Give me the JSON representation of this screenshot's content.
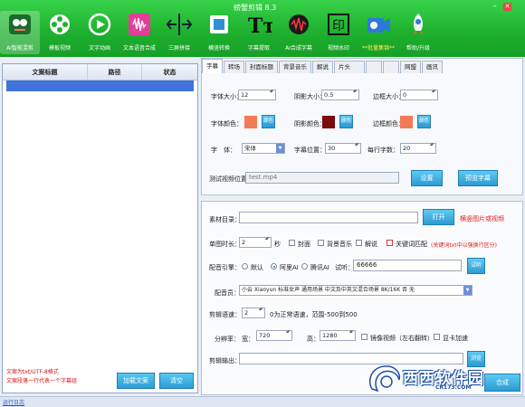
{
  "app": {
    "title": "螃蟹剪辑 8.3"
  },
  "toolbar": {
    "items": [
      {
        "label": "AI智能混剪",
        "icon": "ai-brain-icon"
      },
      {
        "label": "模板视频",
        "icon": "film-reel-icon"
      },
      {
        "label": "文字动画",
        "icon": "text-animation-icon"
      },
      {
        "label": "文本语音合成",
        "icon": "voice-wave-icon"
      },
      {
        "label": "三屏拼接",
        "icon": "split-screen-icon"
      },
      {
        "label": "横竖转换",
        "icon": "rotate-screen-icon"
      },
      {
        "label": "字幕提取",
        "icon": "text-extract-icon"
      },
      {
        "label": "AI合成字幕",
        "icon": "ai-subtitle-icon"
      },
      {
        "label": "视频水印",
        "icon": "watermark-stamp-icon"
      },
      {
        "label": "**批量集锦**",
        "icon": "batch-video-icon"
      },
      {
        "label": "帮助/升级",
        "icon": "rocket-icon"
      }
    ]
  },
  "left": {
    "headers": [
      "文案标题",
      "路径",
      "状态"
    ],
    "hints": [
      "文案为txt/UTF-8格式",
      "文案段落一行代表一个字幕组"
    ],
    "load_button": "加载文案",
    "clear_button": "清空"
  },
  "tabs": [
    "字幕",
    "转场",
    "封面标题",
    "背景音乐",
    "解说",
    "片头",
    "",
    "",
    "网盟",
    "画讯"
  ],
  "subtitle": {
    "font_size_label": "字体大小：",
    "font_size": "12",
    "shadow_size_label": "阴影大小：",
    "shadow_size": "0.5",
    "border_size_label": "边框大小：",
    "border_size": "0",
    "font_color_label": "字体颜色：",
    "shadow_color_label": "阴影颜色：",
    "border_color_label": "边框颜色：",
    "color_button": "颜色",
    "font_label": "字　体：",
    "font_value": "宋体",
    "subtitle_pos_label": "字幕位置：",
    "subtitle_pos": "30",
    "chars_per_line_label": "每行字数：",
    "chars_per_line": "20",
    "test_video_label": "测试视频位置：",
    "test_video": "test.mp4",
    "set_button": "设置",
    "preview_button": "预览字幕",
    "colors": {
      "font": "#f27a56",
      "shadow": "#7a0c0c",
      "border": "#f27a56"
    }
  },
  "material": {
    "dir_label": "素材目录：",
    "dir_value": "",
    "open_button": "打开",
    "dir_hint": "横竖图片或视频",
    "duration_label": "单图时长：",
    "duration": "2",
    "seconds": "秒",
    "cover_label": "封面",
    "bgm_label": "背景音乐",
    "narration_label": "解说",
    "keyword_label": "关键词匹配",
    "keyword_hint": "(关键词txt中以强换行区分)",
    "engine_label": "配音引擎：",
    "engine_default": "默认",
    "engine_ali": "阿里AI",
    "engine_tencent": "腾讯AI",
    "listen_label": "试听：",
    "listen_text": "66666",
    "listen_button": "试听",
    "voice_label": "配音员：",
    "voice_value": "小云 Xiaoyun 标准女声 通用场景 中文及中英文混合场景 8K/16K 否 无",
    "speed_label": "剪辑语速：",
    "speed": "2",
    "speed_hint": "0为正常语速，范围-500到500",
    "resolution_label": "分辨率：",
    "width_label": "宽：",
    "width": "720",
    "height_label": "高：",
    "height": "1280",
    "mirror_label": "镜像视频（左右翻转）",
    "gpu_label": "显卡加速",
    "output_label": "剪辑输出：",
    "output_button": "浏览",
    "compose_button": "合成"
  },
  "status": {
    "link": "运行日志"
  },
  "watermark": {
    "text": "西西软件园",
    "url": "CR173.COM"
  }
}
